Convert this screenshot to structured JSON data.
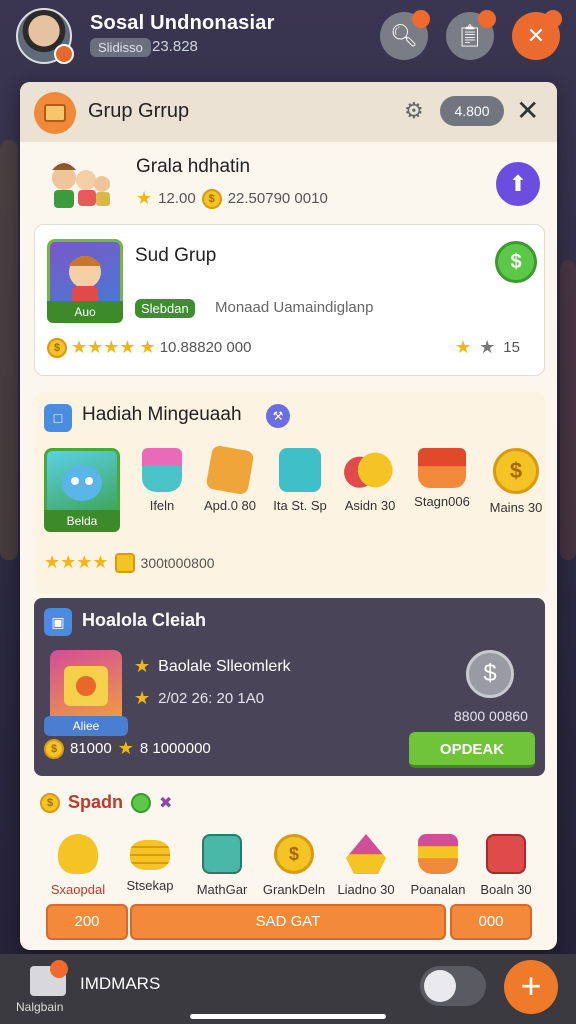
{
  "header": {
    "username": "Sosal Undnonasiar",
    "badge": "Slidisso",
    "value": "23.828",
    "avatar_level": "",
    "buttons": [
      {
        "icon": "search-icon",
        "badge": ""
      },
      {
        "icon": "clipboard-icon",
        "badge": ""
      },
      {
        "icon": "tools-icon",
        "badge": ""
      }
    ]
  },
  "panel": {
    "title": "Grup Grrup",
    "pill": "4.800",
    "row1": {
      "title": "Grala hdhatin",
      "rating": "12.00",
      "coins": "22.50790 0010"
    },
    "card": {
      "title": "Sud Grup",
      "image_label": "Auo",
      "tag": "Slebdan",
      "desc": "Monaad Uamaindiglanp",
      "rating": "10.88820 000",
      "right_value": "15"
    },
    "rewards": {
      "title": "Hadiah Mingeuaah",
      "featured_label": "Belda",
      "items": [
        {
          "label": "Ifeln"
        },
        {
          "label": "Apd.0 80"
        },
        {
          "label": "Ita St. Sp"
        },
        {
          "label": "Asidn 30"
        },
        {
          "label": "Stagn006"
        },
        {
          "label": "Mains 30"
        }
      ],
      "rating": "300t000800"
    },
    "offer": {
      "title": "Hoalola Cleiah",
      "image_label": "Aliee",
      "line1": "Baolale Slleomlerk",
      "line2": "2/02 26: 20 1A0",
      "value": "8800 00860",
      "coins": "81000",
      "extra": "8 1000000",
      "button": "OPDEAK"
    },
    "shop": {
      "title": "Spadn",
      "items": [
        {
          "label": "Sxaopdal"
        },
        {
          "label": "Stsekap"
        },
        {
          "label": "MathGar"
        },
        {
          "label": "GrankDeln"
        },
        {
          "label": "Liadno 30"
        },
        {
          "label": "Poanalan"
        },
        {
          "label": "Boaln 30"
        }
      ],
      "bar": [
        "200",
        "SAD GAT",
        "000"
      ]
    }
  },
  "bottom": {
    "small": "Nalgbain",
    "label": "IMDMARS",
    "plus": "+"
  },
  "colors": {
    "accent": "#ef7a2a",
    "green": "#6fc43a",
    "panel": "#fbf6ee",
    "dark_section": "#4a4458"
  }
}
